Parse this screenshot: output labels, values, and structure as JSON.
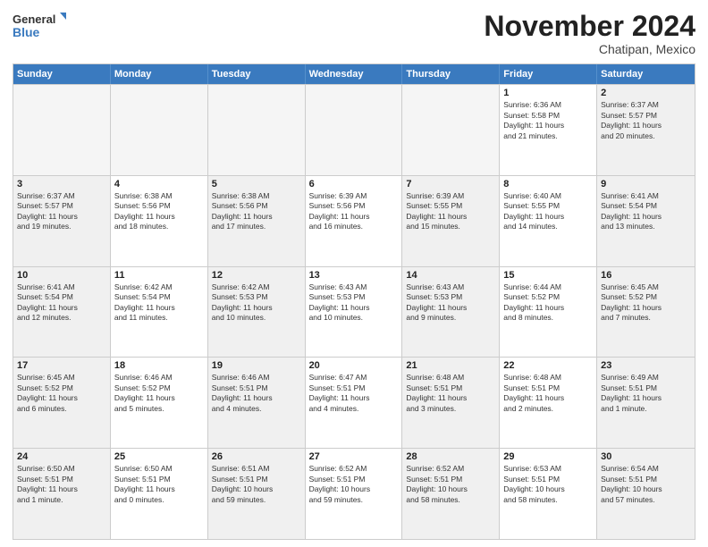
{
  "logo": {
    "line1": "General",
    "line2": "Blue"
  },
  "title": "November 2024",
  "subtitle": "Chatipan, Mexico",
  "header_days": [
    "Sunday",
    "Monday",
    "Tuesday",
    "Wednesday",
    "Thursday",
    "Friday",
    "Saturday"
  ],
  "rows": [
    [
      {
        "day": "",
        "text": "",
        "empty": true
      },
      {
        "day": "",
        "text": "",
        "empty": true
      },
      {
        "day": "",
        "text": "",
        "empty": true
      },
      {
        "day": "",
        "text": "",
        "empty": true
      },
      {
        "day": "",
        "text": "",
        "empty": true
      },
      {
        "day": "1",
        "text": "Sunrise: 6:36 AM\nSunset: 5:58 PM\nDaylight: 11 hours\nand 21 minutes.",
        "empty": false
      },
      {
        "day": "2",
        "text": "Sunrise: 6:37 AM\nSunset: 5:57 PM\nDaylight: 11 hours\nand 20 minutes.",
        "empty": false
      }
    ],
    [
      {
        "day": "3",
        "text": "Sunrise: 6:37 AM\nSunset: 5:57 PM\nDaylight: 11 hours\nand 19 minutes.",
        "empty": false
      },
      {
        "day": "4",
        "text": "Sunrise: 6:38 AM\nSunset: 5:56 PM\nDaylight: 11 hours\nand 18 minutes.",
        "empty": false
      },
      {
        "day": "5",
        "text": "Sunrise: 6:38 AM\nSunset: 5:56 PM\nDaylight: 11 hours\nand 17 minutes.",
        "empty": false
      },
      {
        "day": "6",
        "text": "Sunrise: 6:39 AM\nSunset: 5:56 PM\nDaylight: 11 hours\nand 16 minutes.",
        "empty": false
      },
      {
        "day": "7",
        "text": "Sunrise: 6:39 AM\nSunset: 5:55 PM\nDaylight: 11 hours\nand 15 minutes.",
        "empty": false
      },
      {
        "day": "8",
        "text": "Sunrise: 6:40 AM\nSunset: 5:55 PM\nDaylight: 11 hours\nand 14 minutes.",
        "empty": false
      },
      {
        "day": "9",
        "text": "Sunrise: 6:41 AM\nSunset: 5:54 PM\nDaylight: 11 hours\nand 13 minutes.",
        "empty": false
      }
    ],
    [
      {
        "day": "10",
        "text": "Sunrise: 6:41 AM\nSunset: 5:54 PM\nDaylight: 11 hours\nand 12 minutes.",
        "empty": false
      },
      {
        "day": "11",
        "text": "Sunrise: 6:42 AM\nSunset: 5:54 PM\nDaylight: 11 hours\nand 11 minutes.",
        "empty": false
      },
      {
        "day": "12",
        "text": "Sunrise: 6:42 AM\nSunset: 5:53 PM\nDaylight: 11 hours\nand 10 minutes.",
        "empty": false
      },
      {
        "day": "13",
        "text": "Sunrise: 6:43 AM\nSunset: 5:53 PM\nDaylight: 11 hours\nand 10 minutes.",
        "empty": false
      },
      {
        "day": "14",
        "text": "Sunrise: 6:43 AM\nSunset: 5:53 PM\nDaylight: 11 hours\nand 9 minutes.",
        "empty": false
      },
      {
        "day": "15",
        "text": "Sunrise: 6:44 AM\nSunset: 5:52 PM\nDaylight: 11 hours\nand 8 minutes.",
        "empty": false
      },
      {
        "day": "16",
        "text": "Sunrise: 6:45 AM\nSunset: 5:52 PM\nDaylight: 11 hours\nand 7 minutes.",
        "empty": false
      }
    ],
    [
      {
        "day": "17",
        "text": "Sunrise: 6:45 AM\nSunset: 5:52 PM\nDaylight: 11 hours\nand 6 minutes.",
        "empty": false
      },
      {
        "day": "18",
        "text": "Sunrise: 6:46 AM\nSunset: 5:52 PM\nDaylight: 11 hours\nand 5 minutes.",
        "empty": false
      },
      {
        "day": "19",
        "text": "Sunrise: 6:46 AM\nSunset: 5:51 PM\nDaylight: 11 hours\nand 4 minutes.",
        "empty": false
      },
      {
        "day": "20",
        "text": "Sunrise: 6:47 AM\nSunset: 5:51 PM\nDaylight: 11 hours\nand 4 minutes.",
        "empty": false
      },
      {
        "day": "21",
        "text": "Sunrise: 6:48 AM\nSunset: 5:51 PM\nDaylight: 11 hours\nand 3 minutes.",
        "empty": false
      },
      {
        "day": "22",
        "text": "Sunrise: 6:48 AM\nSunset: 5:51 PM\nDaylight: 11 hours\nand 2 minutes.",
        "empty": false
      },
      {
        "day": "23",
        "text": "Sunrise: 6:49 AM\nSunset: 5:51 PM\nDaylight: 11 hours\nand 1 minute.",
        "empty": false
      }
    ],
    [
      {
        "day": "24",
        "text": "Sunrise: 6:50 AM\nSunset: 5:51 PM\nDaylight: 11 hours\nand 1 minute.",
        "empty": false
      },
      {
        "day": "25",
        "text": "Sunrise: 6:50 AM\nSunset: 5:51 PM\nDaylight: 11 hours\nand 0 minutes.",
        "empty": false
      },
      {
        "day": "26",
        "text": "Sunrise: 6:51 AM\nSunset: 5:51 PM\nDaylight: 10 hours\nand 59 minutes.",
        "empty": false
      },
      {
        "day": "27",
        "text": "Sunrise: 6:52 AM\nSunset: 5:51 PM\nDaylight: 10 hours\nand 59 minutes.",
        "empty": false
      },
      {
        "day": "28",
        "text": "Sunrise: 6:52 AM\nSunset: 5:51 PM\nDaylight: 10 hours\nand 58 minutes.",
        "empty": false
      },
      {
        "day": "29",
        "text": "Sunrise: 6:53 AM\nSunset: 5:51 PM\nDaylight: 10 hours\nand 58 minutes.",
        "empty": false
      },
      {
        "day": "30",
        "text": "Sunrise: 6:54 AM\nSunset: 5:51 PM\nDaylight: 10 hours\nand 57 minutes.",
        "empty": false
      }
    ]
  ]
}
